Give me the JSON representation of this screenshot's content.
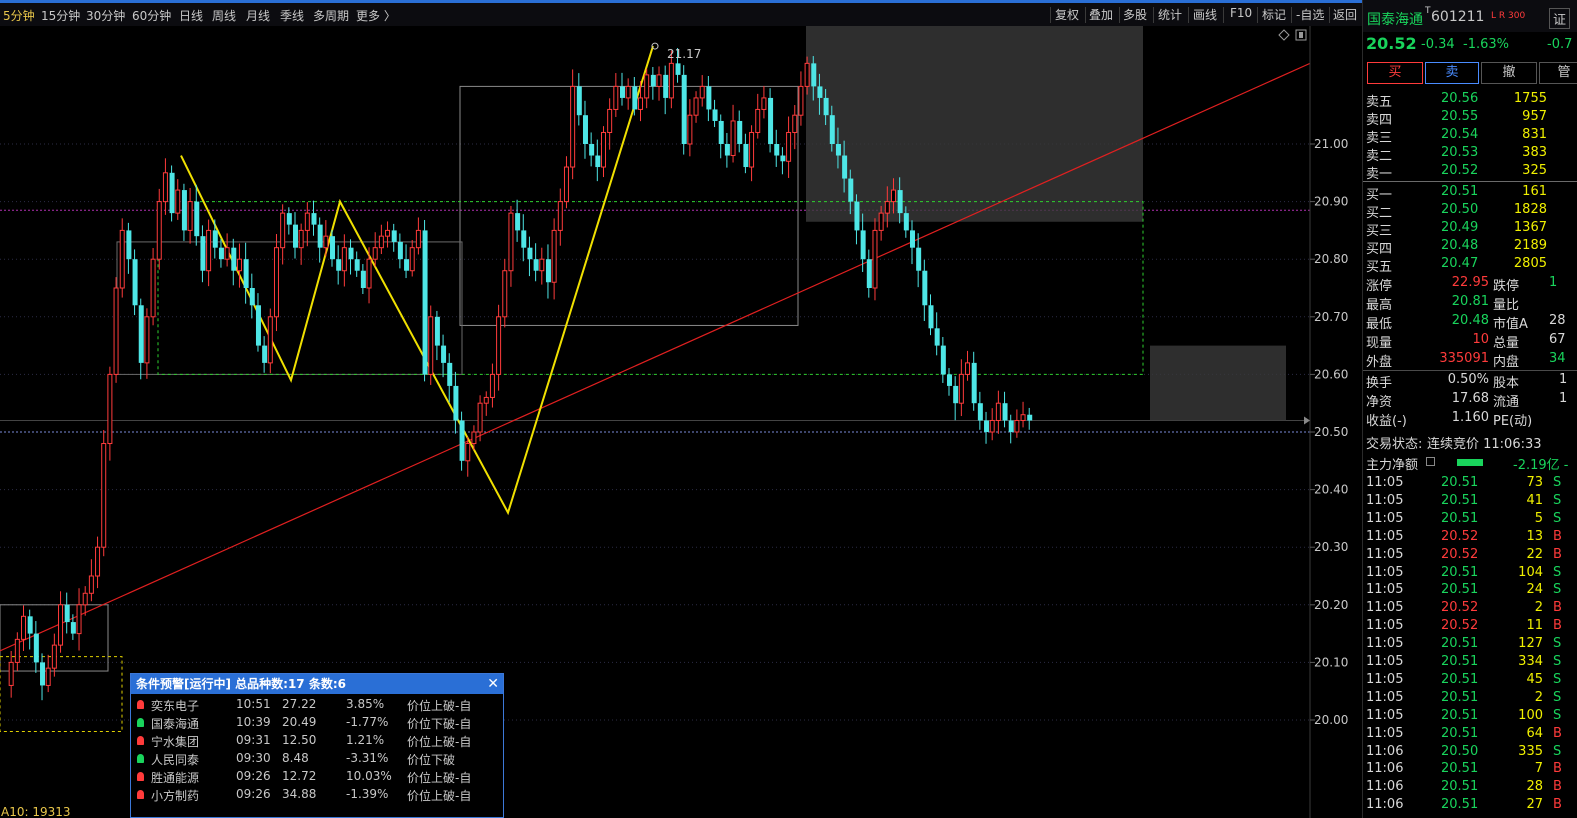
{
  "toolbar": {
    "periods": [
      "5分钟",
      "15分钟",
      "30分钟",
      "60分钟",
      "日线",
      "周线",
      "月线",
      "季线",
      "多周期",
      "更多 〉"
    ],
    "buttons": [
      "复权",
      "叠加",
      "多股",
      "统计",
      "画线",
      "F10",
      "标记",
      "-自选",
      "返回"
    ]
  },
  "chart": {
    "axis_labels": [
      "21.00",
      "20.90",
      "20.80",
      "20.70",
      "20.60",
      "20.50",
      "20.40",
      "20.30",
      "20.20",
      "20.10",
      "20.00"
    ],
    "high_marker": "21.17",
    "bottom_label": "A10: 19313",
    "corner_icons": [
      "diamond-icon",
      "window-icon"
    ]
  },
  "quote": {
    "name": "国泰海通",
    "code": "601211",
    "tag": "T",
    "flags": "L R 300",
    "edge_button": "证",
    "price": "20.52",
    "change": "-0.34",
    "change_pct": "-1.63%",
    "edge_value": "-0.7",
    "buy_label": "买",
    "sell_label": "卖",
    "cancel_label": "撤",
    "edge_label": "管"
  },
  "asks": [
    {
      "label": "卖五",
      "price": "20.56",
      "vol": "1755"
    },
    {
      "label": "卖四",
      "price": "20.55",
      "vol": "957"
    },
    {
      "label": "卖三",
      "price": "20.54",
      "vol": "831"
    },
    {
      "label": "卖二",
      "price": "20.53",
      "vol": "383"
    },
    {
      "label": "卖一",
      "price": "20.52",
      "vol": "325"
    }
  ],
  "bids": [
    {
      "label": "买一",
      "price": "20.51",
      "vol": "161"
    },
    {
      "label": "买二",
      "price": "20.50",
      "vol": "1828"
    },
    {
      "label": "买三",
      "price": "20.49",
      "vol": "1367"
    },
    {
      "label": "买四",
      "price": "20.48",
      "vol": "2189"
    },
    {
      "label": "买五",
      "price": "20.47",
      "vol": "2805"
    }
  ],
  "stats1": [
    {
      "l1": "涨停",
      "v1": "22.95",
      "l2": "跌停",
      "v2": "1"
    },
    {
      "l1": "最高",
      "v1": "20.81",
      "l2": "量比",
      "v2": ""
    },
    {
      "l1": "最低",
      "v1": "20.48",
      "l2": "市值A",
      "v2": "28"
    },
    {
      "l1": "现量",
      "v1": "10",
      "l2": "总量",
      "v2": "67"
    },
    {
      "l1": "外盘",
      "v1": "335091",
      "l2": "内盘",
      "v2": "34"
    }
  ],
  "stats2": [
    {
      "l1": "换手",
      "v1": "0.50%",
      "l2": "股本",
      "v2": "1"
    },
    {
      "l1": "净资",
      "v1": "17.68",
      "l2": "流通",
      "v2": "1"
    },
    {
      "l1": "收益(-)",
      "v1": "1.160",
      "l2": "PE(动)",
      "v2": ""
    }
  ],
  "status": {
    "label": "交易状态:",
    "value": "连续竞价 11:06:33"
  },
  "main_flow": {
    "label": "主力净额",
    "value": "-2.19亿 -"
  },
  "ticks": [
    {
      "t": "11:05",
      "p": "20.51",
      "v": "73",
      "s": "S"
    },
    {
      "t": "11:05",
      "p": "20.51",
      "v": "41",
      "s": "S"
    },
    {
      "t": "11:05",
      "p": "20.51",
      "v": "5",
      "s": "S"
    },
    {
      "t": "11:05",
      "p": "20.52",
      "v": "13",
      "s": "B"
    },
    {
      "t": "11:05",
      "p": "20.52",
      "v": "22",
      "s": "B"
    },
    {
      "t": "11:05",
      "p": "20.51",
      "v": "104",
      "s": "S"
    },
    {
      "t": "11:05",
      "p": "20.51",
      "v": "24",
      "s": "S"
    },
    {
      "t": "11:05",
      "p": "20.52",
      "v": "2",
      "s": "B"
    },
    {
      "t": "11:05",
      "p": "20.52",
      "v": "11",
      "s": "B"
    },
    {
      "t": "11:05",
      "p": "20.51",
      "v": "127",
      "s": "S"
    },
    {
      "t": "11:05",
      "p": "20.51",
      "v": "334",
      "s": "S"
    },
    {
      "t": "11:05",
      "p": "20.51",
      "v": "45",
      "s": "S"
    },
    {
      "t": "11:05",
      "p": "20.51",
      "v": "2",
      "s": "S"
    },
    {
      "t": "11:05",
      "p": "20.51",
      "v": "100",
      "s": "S"
    },
    {
      "t": "11:05",
      "p": "20.51",
      "v": "64",
      "s": "B"
    },
    {
      "t": "11:06",
      "p": "20.50",
      "v": "335",
      "s": "S"
    },
    {
      "t": "11:06",
      "p": "20.51",
      "v": "7",
      "s": "B"
    },
    {
      "t": "11:06",
      "p": "20.51",
      "v": "28",
      "s": "B"
    },
    {
      "t": "11:06",
      "p": "20.51",
      "v": "27",
      "s": "B"
    }
  ],
  "alert": {
    "title": "条件预警[运行中] 总品种数:17 条数:6",
    "rows": [
      {
        "name": "奕东电子",
        "time": "10:51",
        "price": "27.22",
        "pct": "3.85%",
        "cond": "价位上破-自",
        "bell": "red"
      },
      {
        "name": "国泰海通",
        "time": "10:39",
        "price": "20.49",
        "pct": "-1.77%",
        "cond": "价位下破-自",
        "bell": "green"
      },
      {
        "name": "宁水集团",
        "time": "09:31",
        "price": "12.50",
        "pct": "1.21%",
        "cond": "价位上破-自",
        "bell": "red"
      },
      {
        "name": "人民同泰",
        "time": "09:30",
        "price": "8.48",
        "pct": "-3.31%",
        "cond": "价位下破",
        "bell": "green"
      },
      {
        "name": "胜通能源",
        "time": "09:26",
        "price": "12.72",
        "pct": "10.03%",
        "cond": "价位上破-自",
        "bell": "red"
      },
      {
        "name": "小方制药",
        "time": "09:26",
        "price": "34.88",
        "pct": "-1.39%",
        "cond": "价位上破-自",
        "bell": "red"
      }
    ]
  },
  "colors": {
    "up": "#ff3b3b",
    "down": "#4ee6e6",
    "accent": "#2a6fd6",
    "yellow_line": "#f0e000"
  }
}
